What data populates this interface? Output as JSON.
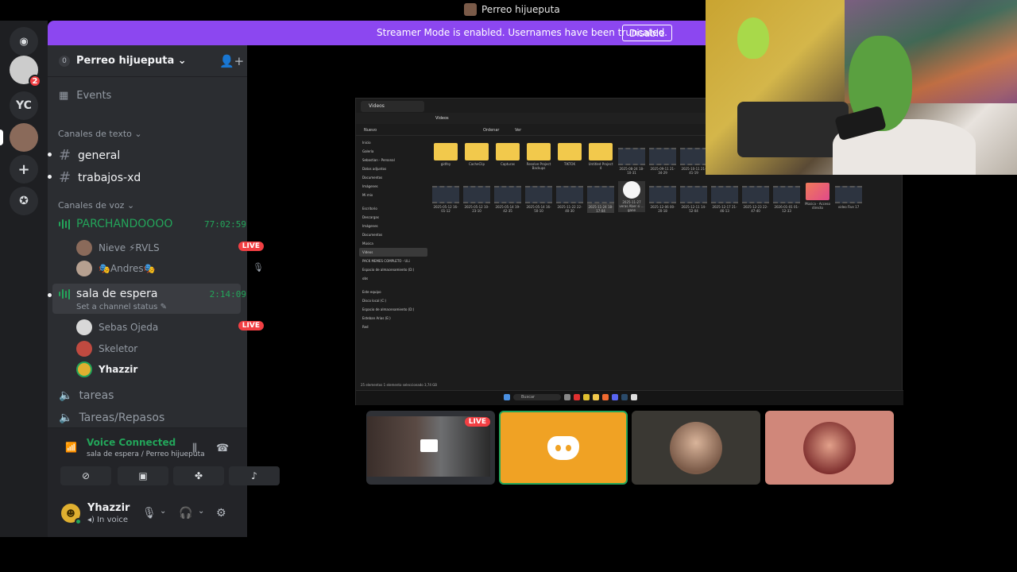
{
  "window": {
    "title": "Perreo hijueputa"
  },
  "rail": {
    "yc_label": "YC",
    "dm_badge": "2"
  },
  "banner": {
    "message": "Streamer Mode is enabled. Usernames have been truncated.",
    "disable_label": "Disable"
  },
  "guild": {
    "name": "Perreo hijueputa",
    "boost_count": "0"
  },
  "sidebar": {
    "events_label": "Events",
    "text_category": "Canales de texto",
    "text_channels": [
      "general",
      "trabajos-xd"
    ],
    "voice_category": "Canales de voz",
    "voice_channels": [
      {
        "name": "PARCHANDOOOO",
        "timer": "77:02:59",
        "users": [
          {
            "name": "Nieve ⚡RVLS",
            "live": "LIVE"
          },
          {
            "name": "🎭Andres🎭"
          }
        ]
      },
      {
        "name": "sala de espera",
        "timer": "2:14:09",
        "status": "Set a channel status",
        "users": [
          {
            "name": "Sebas Ojeda",
            "live": "LIVE"
          },
          {
            "name": "Skeletor"
          },
          {
            "name": "Yhazzir"
          }
        ]
      },
      {
        "name": "tareas"
      },
      {
        "name": "Tareas/Repasos"
      }
    ]
  },
  "voice_panel": {
    "status": "Voice Connected",
    "location": "sala de espera / Perreo hijueputa"
  },
  "user_panel": {
    "name": "Yhazzir",
    "status": "In voice"
  },
  "stream": {
    "tab_label": "Videos",
    "address": "Videos",
    "toolbar": [
      "Nuevo",
      "Ordenar",
      "Ver"
    ],
    "sidebar_items": [
      "Inicio",
      "Galería",
      "Sebastian - Personal",
      "Datos adjuntos",
      "Documentos",
      "Imágenes",
      "Mi mix",
      "Escritorio",
      "Descargas",
      "Imágenes",
      "Documentos",
      "Música",
      "Videos",
      "PACK MEMES COMPLETO - ULi",
      "Espacio de almacenamiento (D:)",
      "obs",
      "Este equipo",
      "Disco local (C:)",
      "Espacio de almacenamiento (D:)",
      "Esteban Arias (E:)",
      "Red"
    ],
    "folders": [
      "gidfey",
      "CacheClip",
      "Capturas",
      "Resolve Project Backups",
      "TIKTOK",
      "Untitled Project 4"
    ],
    "videos_row1": [
      "2025-08-24 18-10-31",
      "2025-09-11 21-34-29",
      "2025-10-11 21-41-19"
    ],
    "videos_row2": [
      "2025-05-12 16-01-12",
      "2025-05-12 10-23-10",
      "2025-05-14 19-42-35",
      "2025-05-14 16-50-10",
      "2025-11-22 22-40-30",
      "2025-11-24 18-17-04",
      "2025-11-27 veras Aber si ... gane",
      "2025-12-06 00-20-18",
      "2025-12-11 14-52-04",
      "2025-12-17 21-46-13",
      "2025-12-23 22-47-40",
      "2026-01-01 01-12-33",
      "Música - Acceso directo",
      "video Five 17"
    ],
    "statusbar": "25 elementos  1 elemento seleccionado 3,74 GB",
    "taskbar_search": "Buscar"
  },
  "tiles": {
    "live_label": "LIVE"
  }
}
